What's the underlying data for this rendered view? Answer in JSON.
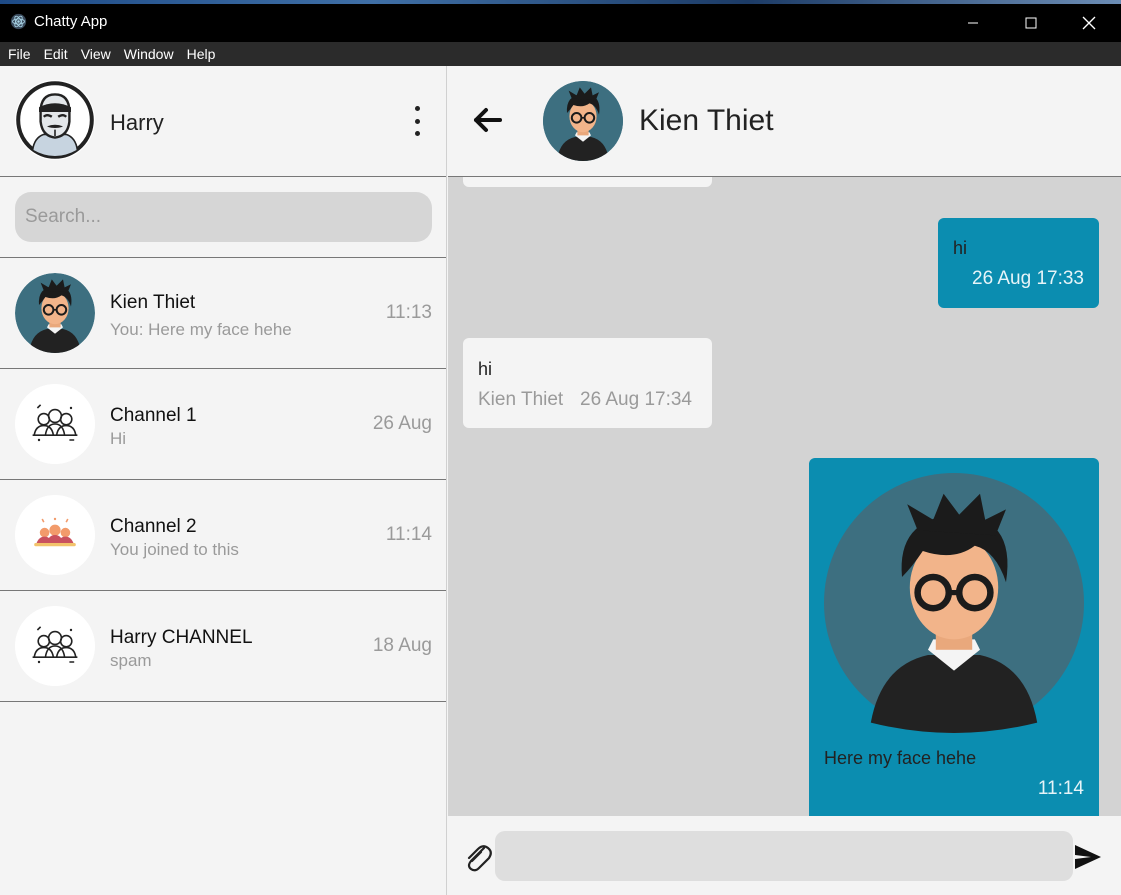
{
  "window": {
    "title": "Chatty App"
  },
  "menu": [
    "File",
    "Edit",
    "View",
    "Window",
    "Help"
  ],
  "profile": {
    "name": "Harry"
  },
  "search": {
    "placeholder": "Search..."
  },
  "conversations": [
    {
      "name": "Kien Thiet",
      "preview": "You: Here my face hehe",
      "time": "11:13",
      "avatar": "boy-glasses-icon"
    },
    {
      "name": "Channel 1",
      "preview": "Hi",
      "time": "26 Aug",
      "avatar": "group-outline-icon"
    },
    {
      "name": "Channel 2",
      "preview": "You joined to this",
      "time": "11:14",
      "avatar": "group-color-icon"
    },
    {
      "name": "Harry CHANNEL",
      "preview": "spam",
      "time": "18 Aug",
      "avatar": "group-outline-icon"
    }
  ],
  "chat": {
    "name": "Kien Thiet",
    "messages": [
      {
        "direction": "out",
        "text": "hi",
        "time": "26 Aug 17:33"
      },
      {
        "direction": "in",
        "text": "hi",
        "sender": "Kien Thiet",
        "time": "26 Aug 17:34"
      },
      {
        "direction": "out",
        "text": "Here my face hehe",
        "time": "11:14",
        "image": "boy-glasses-photo"
      }
    ]
  },
  "composer": {
    "placeholder": ""
  },
  "colors": {
    "outgoing": "#0b8db0",
    "incoming": "#f4f4f4",
    "chat_bg": "#d3d3d3",
    "avatar_bg": "#3d6f80"
  }
}
